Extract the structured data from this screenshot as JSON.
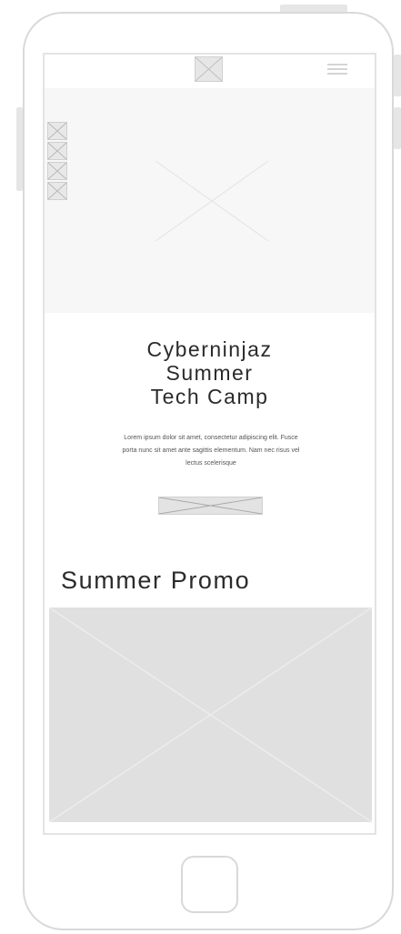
{
  "device": {
    "frame_color": "#d9d9d9"
  },
  "header": {
    "logo_icon": "placeholder-image-icon",
    "menu_icon": "hamburger-menu-icon"
  },
  "hero": {
    "background_color": "#f7f7f7",
    "image_icon": "placeholder-image-icon",
    "social_icons": [
      "social-icon-1",
      "social-icon-2",
      "social-icon-3",
      "social-icon-4"
    ]
  },
  "content": {
    "headline": "Cyberninjaz\nSummer\nTech Camp",
    "body": "Lorem ipsum dolor sit amet, consectetur adipiscing elit. Fusce porta nunc sit amet ante sagittis elementum. Nam nec risus vel lectus scelerisque",
    "cta_icon": "placeholder-button-icon"
  },
  "promo": {
    "title": "Summer Promo",
    "image_icon": "placeholder-image-icon",
    "image_color": "#e0e0e0"
  }
}
